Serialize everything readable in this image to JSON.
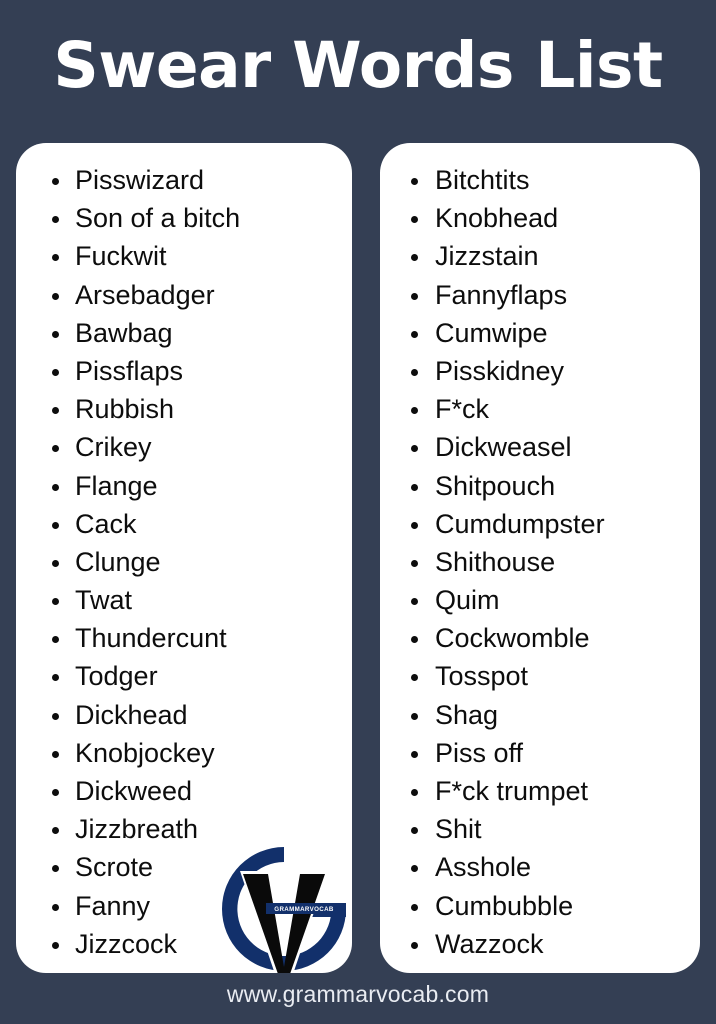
{
  "header": {
    "title": "Swear Words List"
  },
  "theme": {
    "background": "#343f54",
    "card_background": "#ffffff",
    "text_color": "#0d0d0d",
    "title_color": "#ffffff",
    "logo_blue": "#12306b",
    "logo_black": "#0a0a0a",
    "footer_color": "#e9ecf2"
  },
  "columns": [
    {
      "name": "left-column",
      "items": [
        "Pisswizard",
        "Son of a bitch",
        "Fuckwit",
        "Arsebadger",
        "Bawbag",
        "Pissflaps",
        "Rubbish",
        "Crikey",
        "Flange",
        "Cack",
        "Clunge",
        "Twat",
        "Thundercunt",
        "Todger",
        "Dickhead",
        "Knobjockey",
        "Dickweed",
        "Jizzbreath",
        "Scrote",
        "Fanny",
        "Jizzcock"
      ]
    },
    {
      "name": "right-column",
      "items": [
        "Bitchtits",
        "Knobhead",
        "Jizzstain",
        "Fannyflaps",
        "Cumwipe",
        "Pisskidney",
        "F*ck",
        "Dickweasel",
        "Shitpouch",
        "Cumdumpster",
        "Shithouse",
        "Quim",
        "Cockwomble",
        "Tosspot",
        "Shag",
        "Piss off",
        "F*ck trumpet",
        "Shit",
        "Asshole",
        "Cumbubble",
        "Wazzock"
      ]
    }
  ],
  "logo": {
    "name": "grammarvocab-logo",
    "banner_text": "GRAMMARVOCAB"
  },
  "footer": {
    "url": "www.grammarvocab.com"
  }
}
